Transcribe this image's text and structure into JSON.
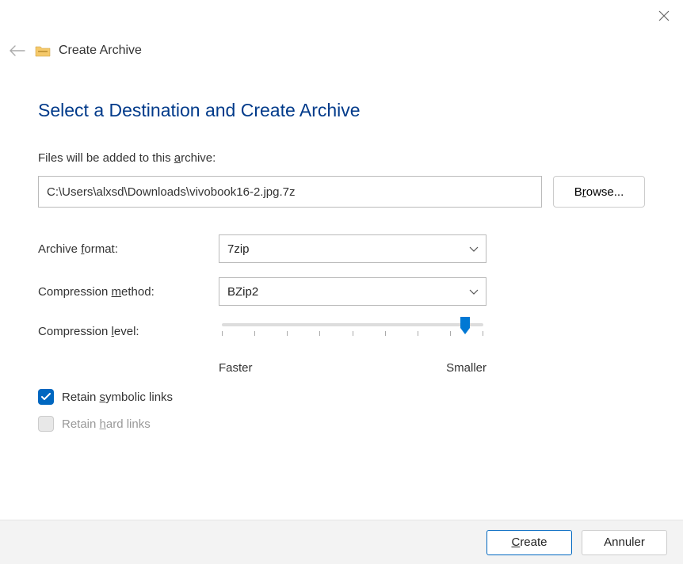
{
  "header": {
    "title": "Create Archive"
  },
  "main": {
    "heading": "Select a Destination and Create Archive",
    "archive_label_pre": "Files will be added to this ",
    "archive_label_u": "a",
    "archive_label_post": "rchive:",
    "archive_path": "C:\\Users\\alxsd\\Downloads\\vivobook16-2.jpg.7z",
    "browse_pre": "B",
    "browse_u": "r",
    "browse_post": "owse...",
    "format_label_pre": "Archive ",
    "format_label_u": "f",
    "format_label_post": "ormat:",
    "format_value": "7zip",
    "method_label_pre": "Compression ",
    "method_label_u": "m",
    "method_label_post": "ethod:",
    "method_value": "BZip2",
    "level_label_pre": "Compression ",
    "level_label_u": "l",
    "level_label_post": "evel:",
    "slider": {
      "left_label": "Faster",
      "right_label": "Smaller"
    },
    "check_symbolic_pre": "Retain ",
    "check_symbolic_u": "s",
    "check_symbolic_post": "ymbolic links",
    "check_hard_pre": "Retain ",
    "check_hard_u": "h",
    "check_hard_post": "ard links"
  },
  "footer": {
    "create_u": "C",
    "create_post": "reate",
    "cancel": "Annuler"
  }
}
